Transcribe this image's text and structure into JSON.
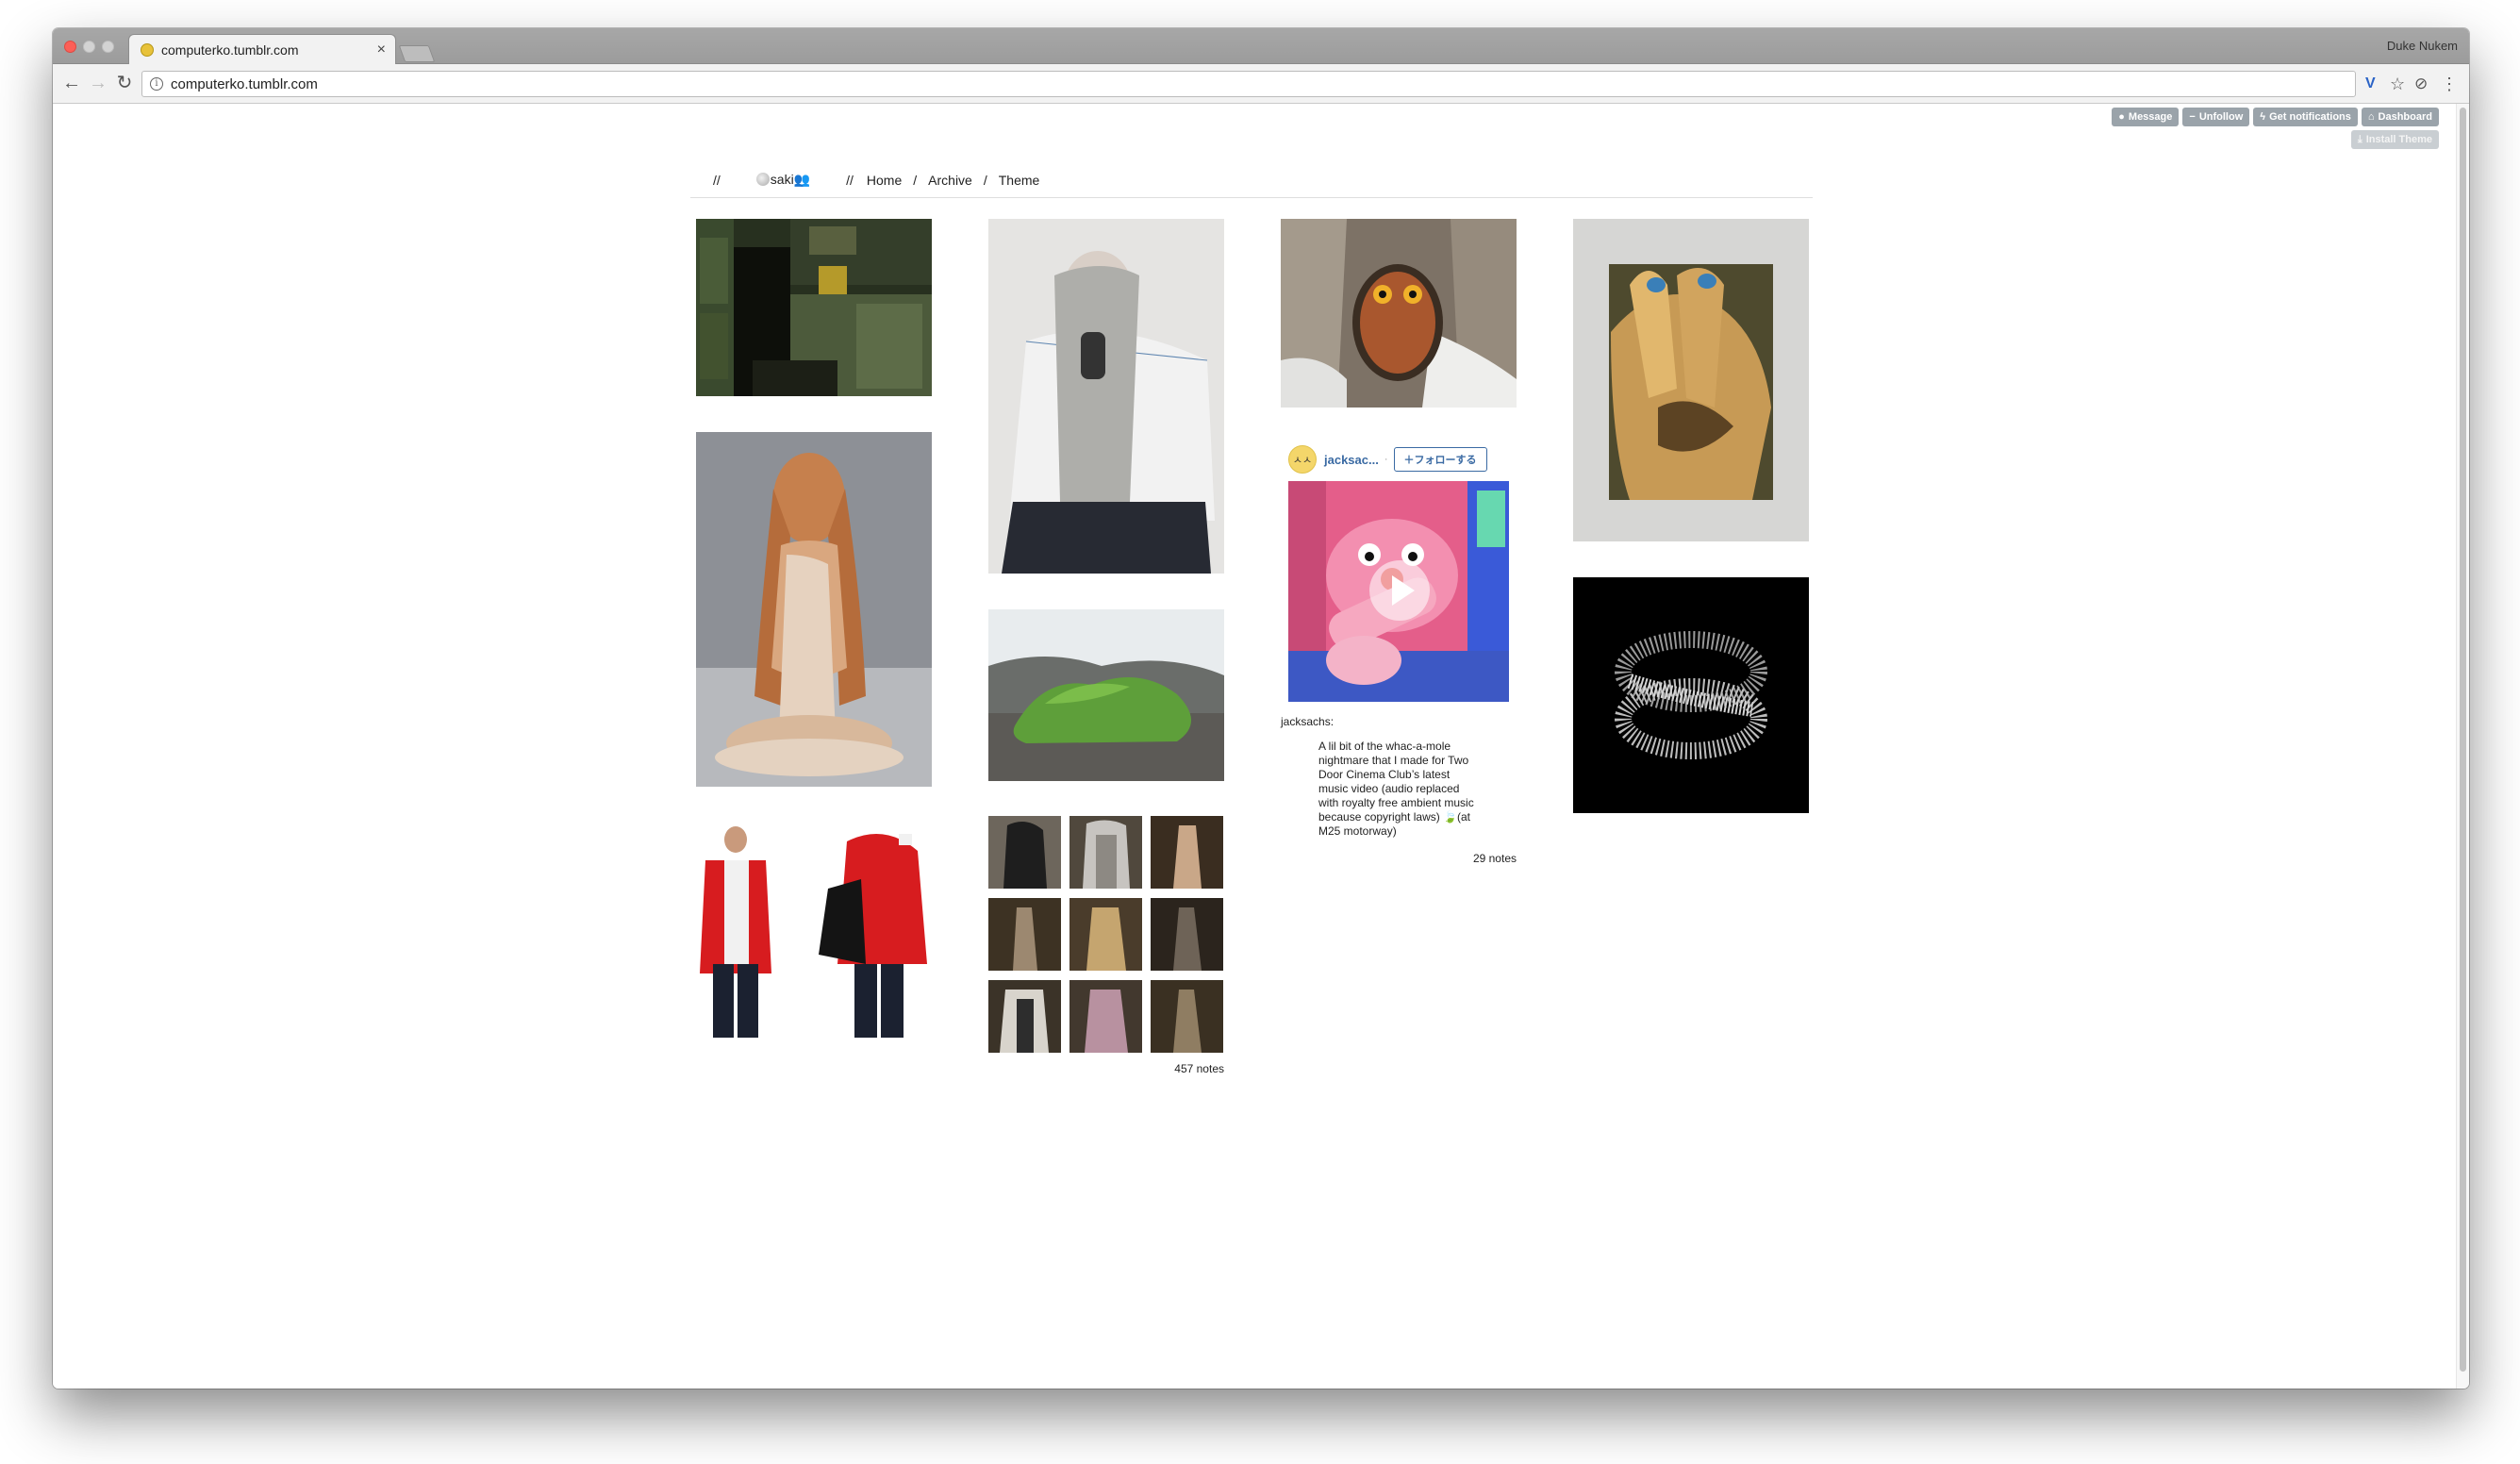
{
  "browser": {
    "tab_title": "computerko.tumblr.com",
    "tab_close": "×",
    "profile_name": "Duke Nukem",
    "url": "computerko.tumblr.com"
  },
  "tumblr_controls": {
    "message": "Message",
    "unfollow": "Unfollow",
    "notifications": "Get notifications",
    "dashboard": "Dashboard",
    "install_theme": "Install Theme"
  },
  "blog_nav": {
    "slash": "//",
    "blog_title": "saki",
    "home": "Home",
    "archive": "Archive",
    "theme": "Theme",
    "sep": "/"
  },
  "photoset": {
    "notes": "457 notes"
  },
  "reblog": {
    "avatar_text": "ㅅㅅ",
    "name": "jacksac...",
    "dot": "·",
    "follow": "＋フォローする",
    "user_label": "jacksachs:",
    "quote": "A lil bit of the whac-a-mole nightmare that I made for Two Door Cinema Club’s latest music video (audio replaced with royalty free ambient music because copyright laws) 🍃(at M25 motorway)",
    "notes": "29 notes"
  },
  "colors": {
    "tumblr_button": "#9aa3aa",
    "link_blue": "#3a6aa3"
  }
}
